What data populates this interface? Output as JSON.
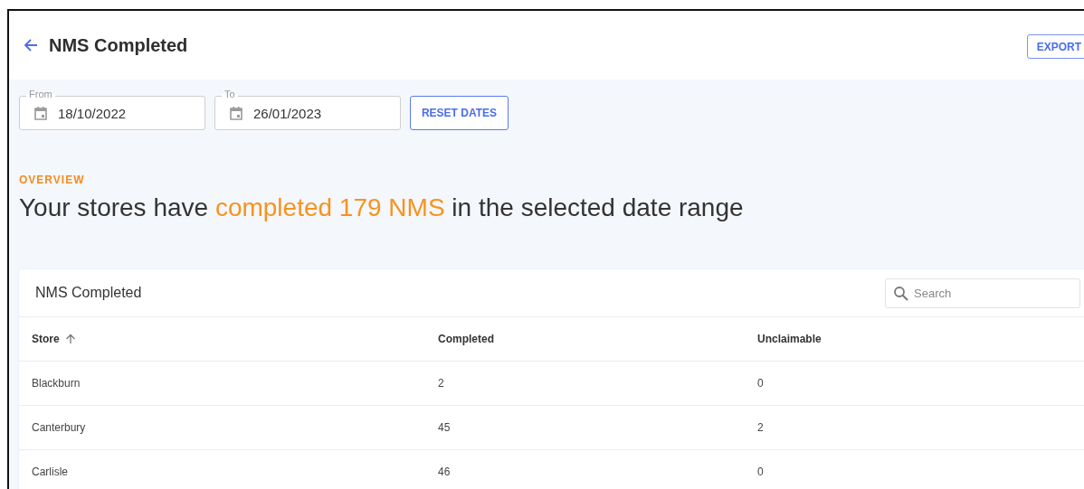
{
  "header": {
    "title": "NMS Completed",
    "export_button": "EXPORT"
  },
  "filters": {
    "fields": [
      {
        "label": "From",
        "value": "18/10/2022"
      },
      {
        "label": "To",
        "value": "26/01/2023"
      }
    ],
    "reset_button": "RESET DATES"
  },
  "overview": {
    "label": "OVERVIEW",
    "headline": [
      {
        "text": "Your stores have ",
        "highlight": false
      },
      {
        "text": "completed 179 NMS",
        "highlight": true
      },
      {
        "text": " in the selected date range",
        "highlight": false
      }
    ]
  },
  "table": {
    "title": "NMS Completed",
    "search": {
      "placeholder": "Search"
    },
    "columns": [
      {
        "label": "Store",
        "sorted": true
      },
      {
        "label": "Completed",
        "sorted": false
      },
      {
        "label": "Unclaimable",
        "sorted": false
      }
    ],
    "rows": [
      [
        "Blackburn",
        "2",
        "0"
      ],
      [
        "Canterbury",
        "45",
        "2"
      ],
      [
        "Carlisle",
        "46",
        "0"
      ]
    ]
  }
}
